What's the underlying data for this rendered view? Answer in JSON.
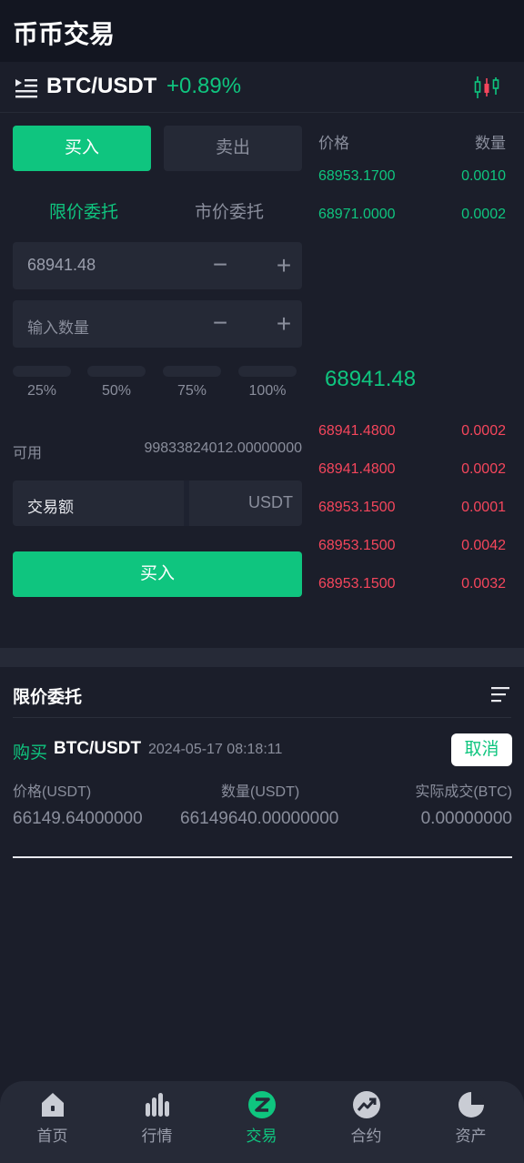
{
  "header": {
    "title": "币币交易"
  },
  "pair_bar": {
    "pair": "BTC/USDT",
    "change": "+0.89%",
    "menu_icon": "list-menu-icon",
    "chart_icon": "candlestick-icon"
  },
  "trade_form": {
    "buy_tab": "买入",
    "sell_tab": "卖出",
    "order_types": [
      "限价委托",
      "市价委托"
    ],
    "price_value": "68941.48",
    "quantity_placeholder": "输入数量",
    "minus": "−",
    "plus": "+",
    "percentages": [
      "25%",
      "50%",
      "75%",
      "100%"
    ],
    "available_label": "可用",
    "available_value": "99833824012.00000000",
    "amount_label": "交易额",
    "amount_unit": "USDT",
    "submit_label": "买入"
  },
  "order_book": {
    "price_header": "价格",
    "qty_header": "数量",
    "asks": [
      {
        "price": "68953.1700",
        "qty": "0.0010"
      },
      {
        "price": "68971.0000",
        "qty": "0.0002"
      }
    ],
    "last_price": "68941.48",
    "bids": [
      {
        "price": "68941.4800",
        "qty": "0.0002"
      },
      {
        "price": "68941.4800",
        "qty": "0.0002"
      },
      {
        "price": "68953.1500",
        "qty": "0.0001"
      },
      {
        "price": "68953.1500",
        "qty": "0.0042"
      },
      {
        "price": "68953.1500",
        "qty": "0.0032"
      }
    ],
    "ask_color": "#0fc57f",
    "bid_color": "#f5465c"
  },
  "orders": {
    "title": "限价委托",
    "filter_icon": "filter-lines-icon",
    "items": [
      {
        "side": "购买",
        "pair": "BTC/USDT",
        "time": "2024-05-17 08:18:11",
        "cancel_label": "取消",
        "col_headers": [
          "价格(USDT)",
          "数量(USDT)",
          "实际成交(BTC)"
        ],
        "col_values": [
          "66149.64000000",
          "66149640.00000000",
          "0.00000000"
        ]
      }
    ]
  },
  "tabbar": {
    "active": "交易",
    "items": [
      {
        "label": "首页",
        "icon": "home-icon"
      },
      {
        "label": "行情",
        "icon": "market-bars-icon"
      },
      {
        "label": "交易",
        "icon": "trade-icon"
      },
      {
        "label": "合约",
        "icon": "contract-trend-icon"
      },
      {
        "label": "资产",
        "icon": "assets-pie-icon"
      }
    ]
  },
  "colors": {
    "accent": "#0fc57f",
    "danger": "#f5465c",
    "background": "#1b1e2a"
  }
}
